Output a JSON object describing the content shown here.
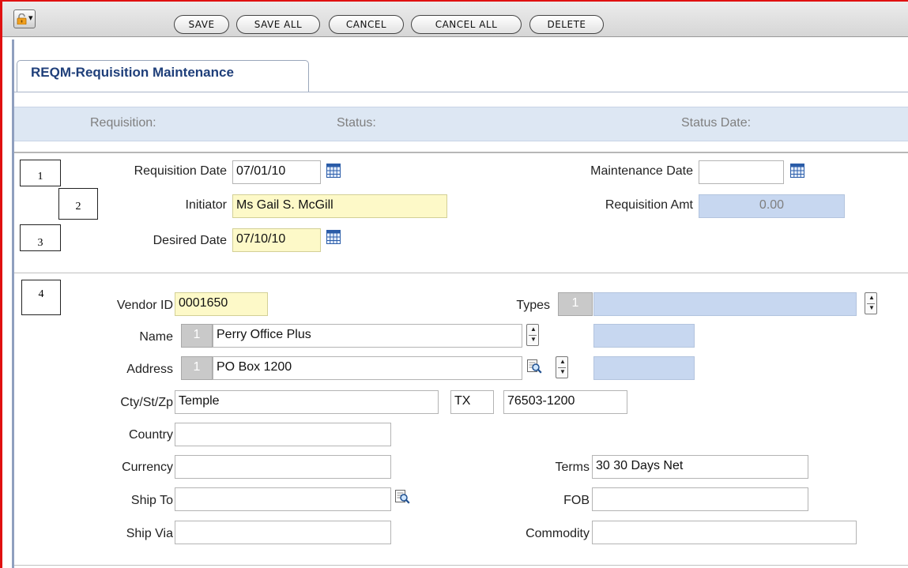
{
  "toolbar": {
    "buttons": {
      "save": "SAVE",
      "save_all": "SAVE ALL",
      "cancel": "CANCEL",
      "cancel_all": "CANCEL ALL",
      "delete": "DELETE"
    }
  },
  "tab": {
    "title": "REQM-Requisition Maintenance"
  },
  "status_strip": {
    "requisition": "Requisition:",
    "status": "Status:",
    "status_date": "Status Date:"
  },
  "markers": {
    "m1": "1",
    "m2": "2",
    "m3": "3",
    "m4": "4"
  },
  "header": {
    "requisition_date": {
      "label": "Requisition Date",
      "value": "07/01/10"
    },
    "initiator": {
      "label": "Initiator",
      "value": "Ms Gail S. McGill"
    },
    "desired_date": {
      "label": "Desired Date",
      "value": "07/10/10"
    },
    "maintenance_date": {
      "label": "Maintenance Date",
      "value": ""
    },
    "requisition_amt": {
      "label": "Requisition Amt",
      "value": "0.00"
    }
  },
  "vendor": {
    "vendor_id": {
      "label": "Vendor ID",
      "value": "0001650"
    },
    "types": {
      "label": "Types",
      "index": "1",
      "value": ""
    },
    "name": {
      "label": "Name",
      "index": "1",
      "value": "Perry Office Plus"
    },
    "address": {
      "label": "Address",
      "index": "1",
      "value": "PO Box 1200"
    },
    "cty_st_zp": {
      "label": "Cty/St/Zp",
      "city": "Temple",
      "state": "TX",
      "zip": "76503-1200"
    },
    "country": {
      "label": "Country",
      "value": ""
    },
    "currency": {
      "label": "Currency",
      "value": ""
    },
    "ship_to": {
      "label": "Ship To",
      "value": ""
    },
    "ship_via": {
      "label": "Ship Via",
      "value": ""
    },
    "terms": {
      "label": "Terms",
      "value": "30 30 Days Net"
    },
    "fob": {
      "label": "FOB",
      "value": ""
    },
    "commodity": {
      "label": "Commodity",
      "value": ""
    }
  },
  "icons": {
    "lock": "lock-icon",
    "calendar": "calendar-icon",
    "spinner": "spinner-icon",
    "lookup": "magnifier-lookup-icon"
  },
  "colors": {
    "frame_red": "#e01010",
    "tab_title": "#1f3f7a",
    "required_field": "#fdf9c8",
    "readonly_field": "#c7d7f0",
    "status_strip": "#dde7f3"
  }
}
